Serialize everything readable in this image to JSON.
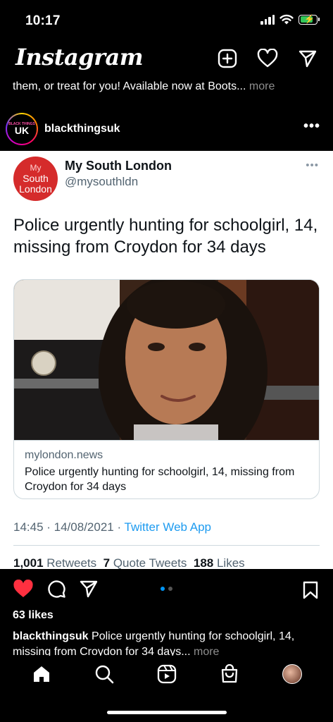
{
  "status": {
    "time": "10:17"
  },
  "header": {
    "logo": "Instagram",
    "new_post_icon": "plus-square-icon",
    "activity_icon": "heart-icon",
    "messages_icon": "paper-plane-icon"
  },
  "prev_caption": {
    "text": "them, or treat for you! Available now at Boots...",
    "more": "more"
  },
  "post": {
    "username": "blackthingsuk",
    "avatar_small": "BLACK THINGS",
    "avatar_big": "UK",
    "more": "•••"
  },
  "tweet": {
    "avatar_line1": "My",
    "avatar_line2": "South",
    "avatar_line3": "London",
    "name": "My South London",
    "handle": "@mysouthldn",
    "more": "•••",
    "text": "Police urgently hunting for schoolgirl, 14, missing from Croydon for 34 days",
    "card": {
      "domain": "mylondon.news",
      "title": "Police urgently hunting for schoolgirl, 14, missing from Croydon for 34 days"
    },
    "timestamp": "14:45 · 14/08/2021 · ",
    "source": "Twitter Web App",
    "retweets_count": "1,001",
    "retweets_label": "Retweets",
    "quotes_count": "7",
    "quotes_label": "Quote Tweets",
    "likes_count": "188",
    "likes_label": "Likes"
  },
  "actions": {
    "like_icon": "heart-filled-icon",
    "comment_icon": "comment-icon",
    "share_icon": "paper-plane-icon",
    "save_icon": "bookmark-icon",
    "carousel_pages": 2,
    "carousel_active": 1
  },
  "likes": "63 likes",
  "caption": {
    "username": "blackthingsuk",
    "text": " Police urgently hunting for schoolgirl, 14, missing from Croydon for 34 days...",
    "more": "more"
  },
  "nav": [
    "home-icon",
    "search-icon",
    "reels-icon",
    "shop-icon",
    "profile-avatar"
  ],
  "colors": {
    "like_red": "#ff3040",
    "twitter_blue": "#1d9bf0",
    "avatar_red": "#d52b2b",
    "carousel_active": "#0095f6"
  }
}
